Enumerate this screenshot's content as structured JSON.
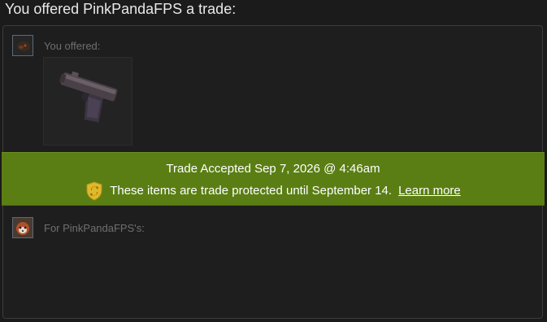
{
  "header": {
    "title": "You offered PinkPandaFPS a trade:"
  },
  "offer": {
    "label": "You offered:",
    "avatar_icon": "dark-avatar-icon",
    "items": [
      {
        "icon": "pistol-icon"
      }
    ]
  },
  "receive": {
    "label": "For PinkPandaFPS's:",
    "avatar_icon": "red-panda-avatar-icon"
  },
  "banner": {
    "status": "Trade Accepted Sep 7, 2026 @ 4:46am",
    "protection_text": "These items are trade protected until September 14.",
    "learn_more": "Learn more",
    "icon": "trade-protection-shield-icon",
    "color": "#5a7e14"
  }
}
